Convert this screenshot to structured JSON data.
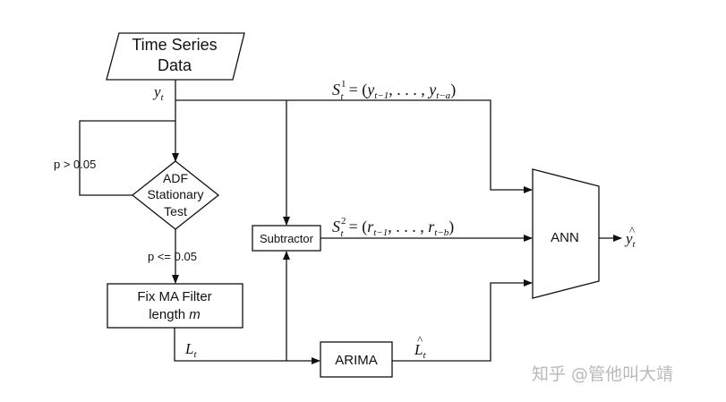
{
  "nodes": {
    "data_source": {
      "line1": "Time Series",
      "line2": "Data"
    },
    "adf": {
      "line1": "ADF",
      "line2": "Stationary",
      "line3": "Test"
    },
    "ma_filter": {
      "line1": "Fix MA Filter",
      "line2_prefix": "length ",
      "line2_var": "m"
    },
    "subtractor": {
      "label": "Subtractor"
    },
    "arima": {
      "label": "ARIMA"
    },
    "ann": {
      "label": "ANN"
    }
  },
  "edge_labels": {
    "p_gt": "p > 0.05",
    "p_le": "p <= 0.05"
  },
  "math": {
    "yt": {
      "base": "y",
      "sub": "t"
    },
    "Lt": {
      "base": "L",
      "sub": "t"
    },
    "Lhat": {
      "hat": "^",
      "base": "L",
      "sub": "t"
    },
    "yhat": {
      "hat": "^",
      "base": "y",
      "sub": "t"
    },
    "s1": {
      "base": "S",
      "sup": "1",
      "sub": "t",
      "rhs_open": "= (",
      "a": "y",
      "a_sub": "t−1",
      "dots": ", . . . , ",
      "b": "y",
      "b_sub": "t−a",
      "rhs_close": ")"
    },
    "s2": {
      "base": "S",
      "sup": "2",
      "sub": "t",
      "rhs_open": "= (",
      "a": "r",
      "a_sub": "t−1",
      "dots": ", . . . , ",
      "b": "r",
      "b_sub": "t−b",
      "rhs_close": ")"
    }
  },
  "watermark": "知乎 @管他叫大靖"
}
